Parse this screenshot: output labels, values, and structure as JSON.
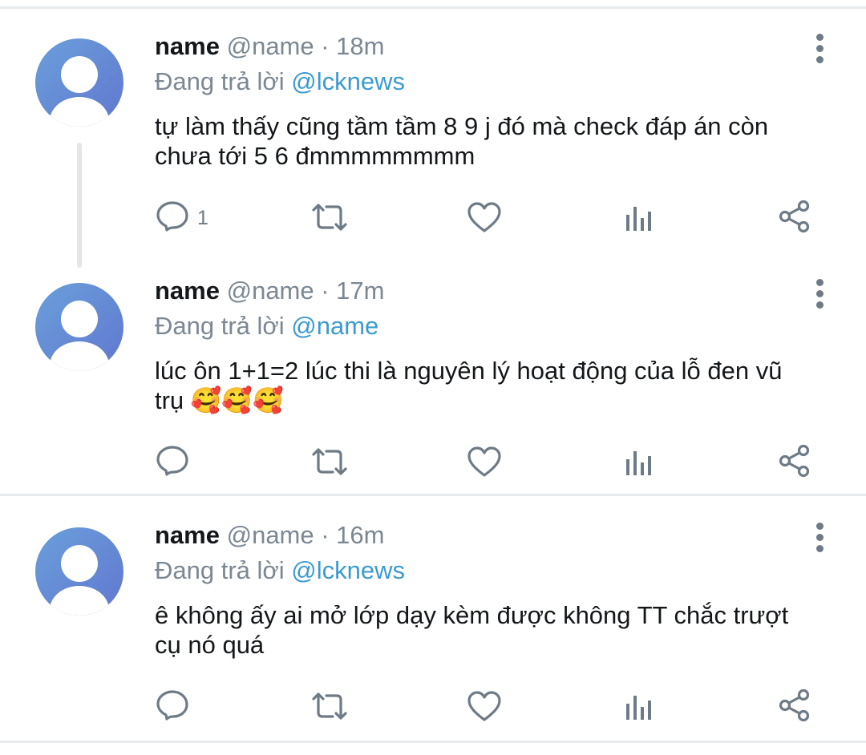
{
  "tweets": [
    {
      "name": "name",
      "handle": "@name",
      "time": "· 18m",
      "replying_prefix": "Đang trả lời",
      "replying_to": "@lcknews",
      "text_line1": "tự làm thấy cũng tầm tầm 8 9 j đó mà check đáp án còn",
      "text_line2": "chưa tới 5 6 đmmmmmmmm",
      "reply_count": "1"
    },
    {
      "name": "name",
      "handle": "@name",
      "time": "· 17m",
      "replying_prefix": "Đang trả lời",
      "replying_to": "@name",
      "text_line1": "lúc ôn 1+1=2 lúc thi là nguyên lý hoạt động của lỗ đen vũ",
      "text_line2": "trụ 🥰🥰🥰",
      "reply_count": ""
    },
    {
      "name": "name",
      "handle": "@name",
      "time": "· 16m",
      "replying_prefix": "Đang trả lời",
      "replying_to": "@lcknews",
      "text_line1": "ê không ấy ai mở lớp dạy kèm được không TT chắc trượt",
      "text_line2": "cụ nó quá",
      "reply_count": ""
    }
  ],
  "icons": {
    "reply": "speech-bubble-icon",
    "retweet": "retweet-arrows-icon",
    "like": "heart-icon",
    "analytics": "bar-chart-icon",
    "share": "share-nodes-icon",
    "more": "vertical-dots-icon"
  },
  "colors": {
    "text_primary": "#14171a",
    "text_secondary": "#7b8792",
    "mention": "#3b9bd1",
    "avatar_gradient": [
      "#6a9fdb",
      "#6177cf"
    ],
    "divider": "#e8ebee"
  }
}
